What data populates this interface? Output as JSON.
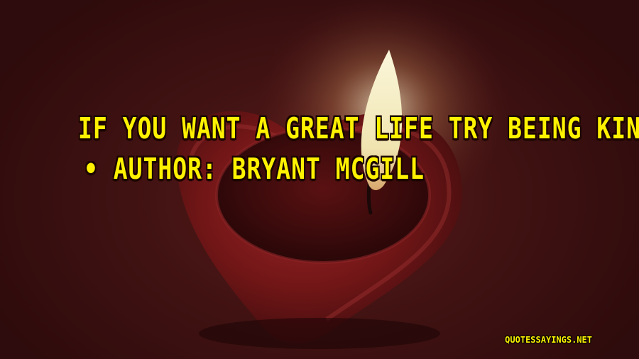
{
  "quote": {
    "text": "If you want a great life try being kind.",
    "author_line": "• Author: Bryant McGill"
  },
  "watermark": {
    "text": "QUOTESSAYINGS.NET"
  },
  "colors": {
    "text": "#fff200",
    "background": "#3a0f10",
    "heart": "#8a1b1d",
    "flame": "#f4f0c8"
  }
}
